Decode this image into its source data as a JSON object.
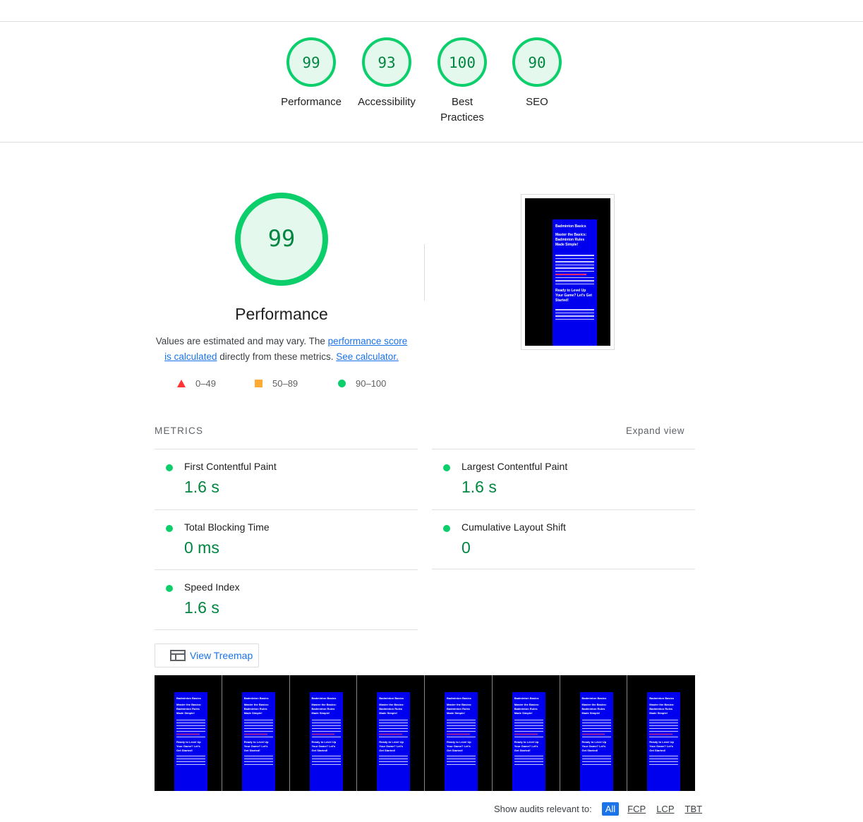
{
  "categories": [
    {
      "label": "Performance",
      "score": 99
    },
    {
      "label": "Accessibility",
      "score": 93
    },
    {
      "label": "Best Practices",
      "score": 100
    },
    {
      "label": "SEO",
      "score": 90
    }
  ],
  "performance": {
    "score": 99,
    "title": "Performance",
    "desc_prefix": "Values are estimated and may vary. The ",
    "desc_link1": "performance score is calculated",
    "desc_middle": " directly from these metrics. ",
    "desc_link2": "See calculator."
  },
  "legend": [
    {
      "shape": "triangle",
      "range": "0–49",
      "color": "#ff3333"
    },
    {
      "shape": "square",
      "range": "50–89",
      "color": "#ffaa33"
    },
    {
      "shape": "circle",
      "range": "90–100",
      "color": "#0cce6b"
    }
  ],
  "metrics_header": "METRICS",
  "expand_view": "Expand view",
  "metrics": [
    {
      "name": "First Contentful Paint",
      "value": "1.6 s"
    },
    {
      "name": "Largest Contentful Paint",
      "value": "1.6 s"
    },
    {
      "name": "Total Blocking Time",
      "value": "0 ms"
    },
    {
      "name": "Cumulative Layout Shift",
      "value": "0"
    },
    {
      "name": "Speed Index",
      "value": "1.6 s"
    }
  ],
  "treemap_label": "View Treemap",
  "screenshot": {
    "site_title": "Badminton Basics",
    "headline": "Master the Basics: Badminton Rules Made Simple!",
    "cta": "Ready to Level Up Your Game? Let's Get Started!"
  },
  "filmstrip_count": 8,
  "audit_filter": {
    "label": "Show audits relevant to:",
    "options": [
      "All",
      "FCP",
      "LCP",
      "TBT"
    ],
    "active": "All"
  },
  "colors": {
    "pass": "#0cce6b",
    "pass_text": "#018642",
    "pass_bg": "#e5f8ee",
    "link": "#1a73e8"
  }
}
